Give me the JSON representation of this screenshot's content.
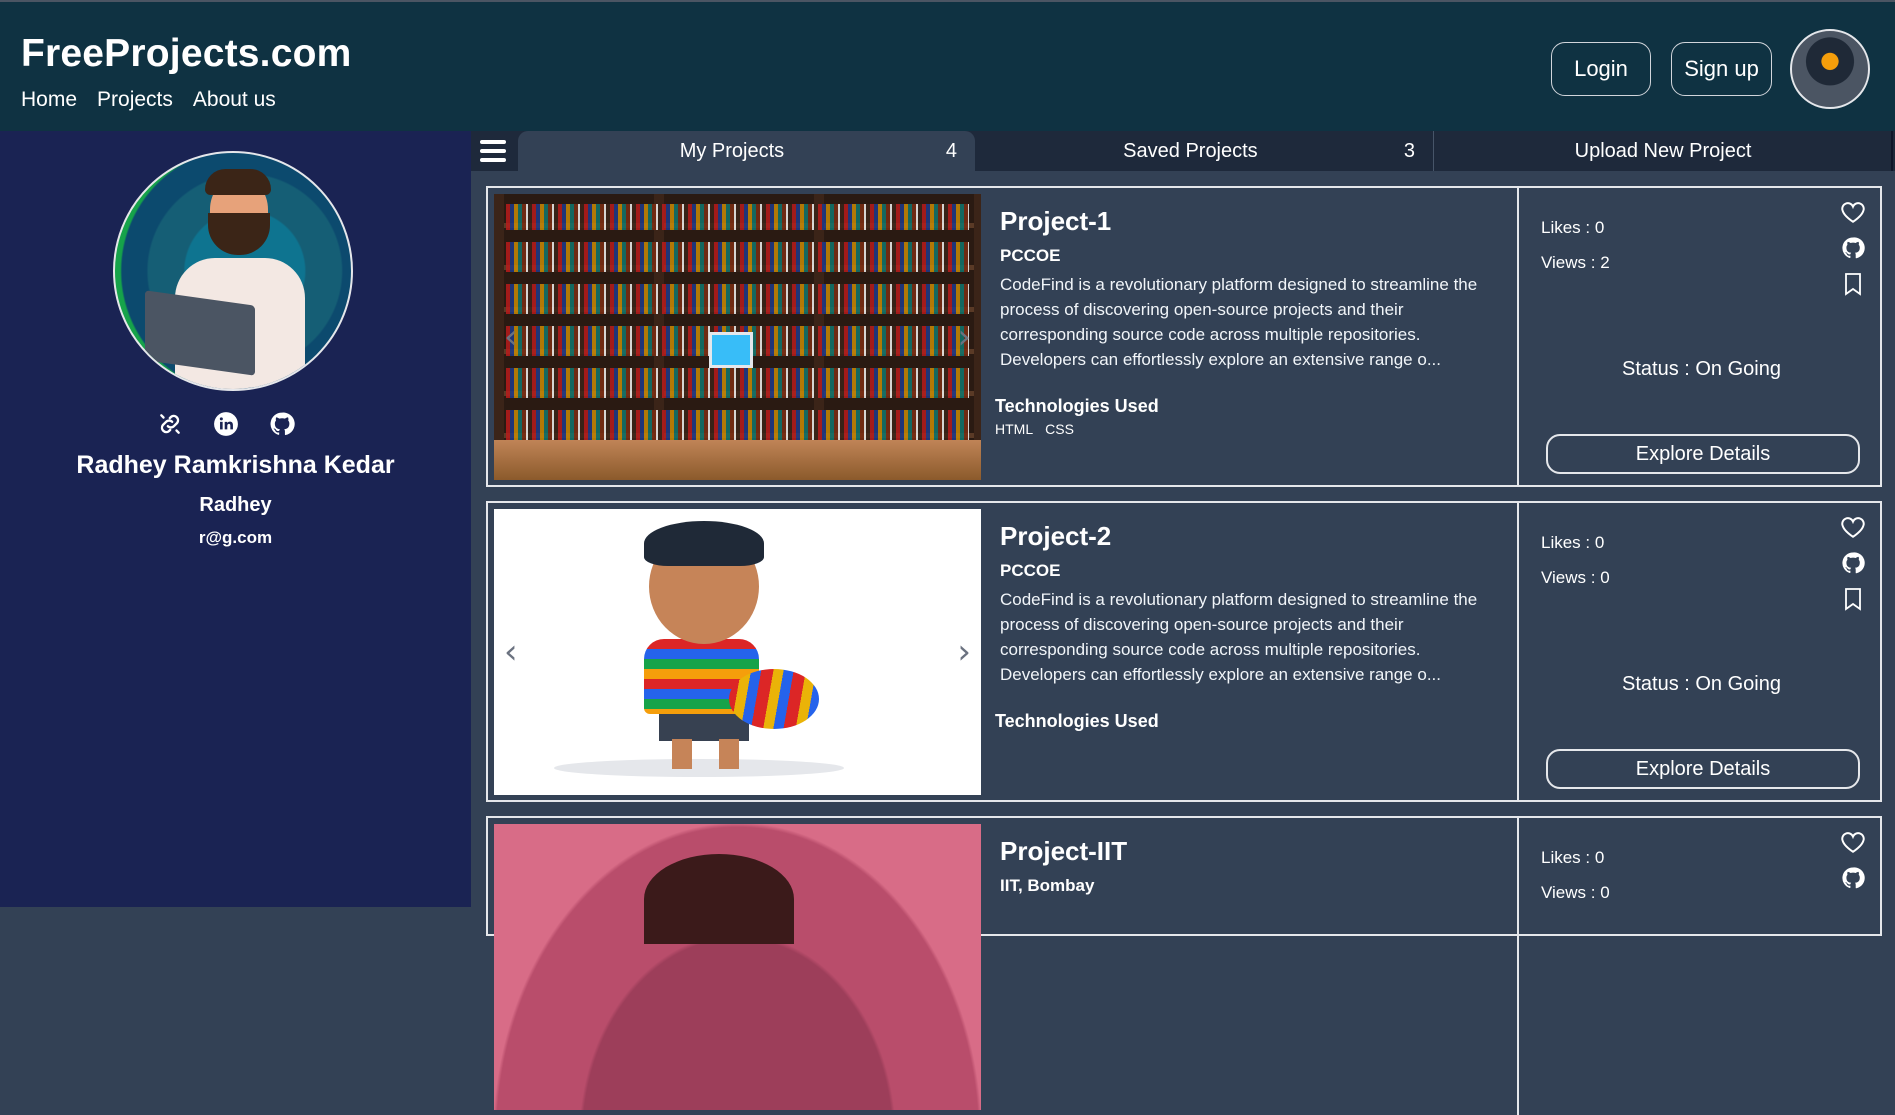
{
  "header": {
    "brand": "FreeProjects.com",
    "nav": [
      "Home",
      "Projects",
      "About us"
    ],
    "login_label": "Login",
    "signup_label": "Sign up"
  },
  "profile": {
    "full_name": "Radhey Ramkrishna Kedar",
    "username": "Radhey",
    "email": "r@g.com",
    "social_icons": [
      "link-icon",
      "linkedin-icon",
      "github-icon"
    ]
  },
  "tabs": [
    {
      "label": "My Projects",
      "count": "4"
    },
    {
      "label": "Saved Projects",
      "count": "3"
    },
    {
      "label": "Upload New Project",
      "count": ""
    }
  ],
  "projects": [
    {
      "title": "Project-1",
      "org": "PCCOE",
      "description": "CodeFind is a revolutionary platform designed to streamline the process of discovering open-source projects and their corresponding source code across multiple repositories. Developers can effortlessly explore an extensive range o...",
      "tech_heading": "Technologies Used",
      "technologies": [
        "HTML",
        "CSS"
      ],
      "likes": "Likes : 0",
      "views": "Views : 2",
      "status": "Status : On Going",
      "explore_label": "Explore Details"
    },
    {
      "title": "Project-2",
      "org": "PCCOE",
      "description": "CodeFind is a revolutionary platform designed to streamline the process of discovering open-source projects and their corresponding source code across multiple repositories. Developers can effortlessly explore an extensive range o...",
      "tech_heading": "Technologies Used",
      "technologies": [],
      "likes": "Likes : 0",
      "views": "Views : 0",
      "status": "Status : On Going",
      "explore_label": "Explore Details"
    },
    {
      "title": "Project-IIT",
      "org": "IIT, Bombay",
      "likes": "Likes : 0",
      "views": "Views : 0"
    }
  ],
  "colors": {
    "header_bg": "#0f3242",
    "sidebar_bg": "#1a2353",
    "content_bg": "#334155",
    "tab_bar_bg": "#1e293b"
  }
}
